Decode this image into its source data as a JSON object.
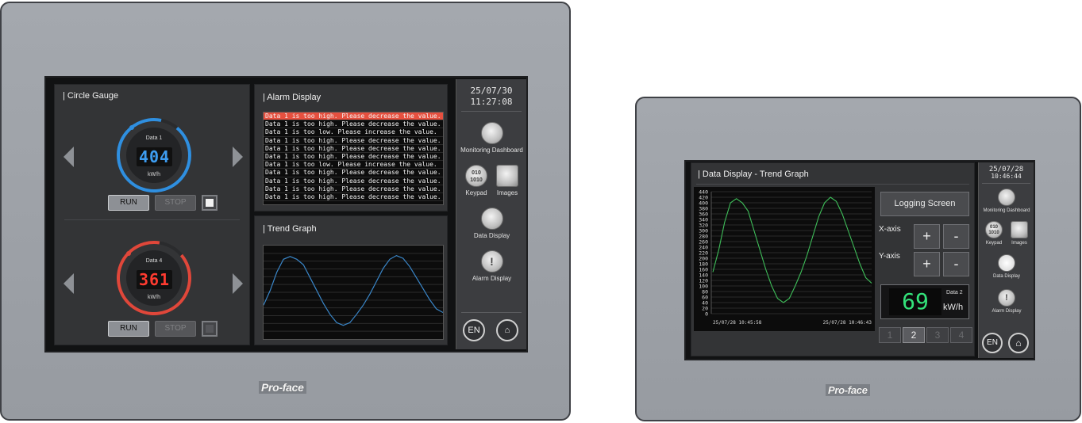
{
  "brand": "Pro-face",
  "colors": {
    "gauge_blue": "#2f8fe0",
    "gauge_red": "#e0473a",
    "alarm_highlight": "#e6503f",
    "trend_blue": "#3a86c8",
    "trend_green": "#3fbf5a",
    "value_green": "#33e27a"
  },
  "device1": {
    "circle_gauge": {
      "title": "| Circle Gauge",
      "gauges": [
        {
          "label": "Data 1",
          "value": "404",
          "unit": "kW/h",
          "color": "#2f8fe0",
          "digit_color": "#3d9cf0"
        },
        {
          "label": "Data 4",
          "value": "361",
          "unit": "kW/h",
          "color": "#e0473a",
          "digit_color": "#ff3b30"
        }
      ],
      "run_label": "RUN",
      "stop_label": "STOP"
    },
    "alarm_display": {
      "title": "| Alarm Display",
      "rows": [
        "Data 1 is too high. Please decrease the value.",
        "Data 1 is too high. Please decrease the value.",
        "Data 1 is too low. Please increase the value.",
        "Data 1 is too high. Please decrease the value.",
        "Data 1 is too high. Please decrease the value.",
        "Data 1 is too high. Please decrease the value.",
        "Data 1 is too low. Please increase the value.",
        "Data 1 is too high. Please decrease the value.",
        "Data 1 is too high. Please decrease the value.",
        "Data 1 is too high. Please decrease the value.",
        "Data 1 is too high. Please decrease the value."
      ]
    },
    "trend_graph": {
      "title": "| Trend Graph"
    },
    "sidebar": {
      "date": "25/07/30",
      "time": "11:27:08",
      "monitoring_label": "Monitoring Dashboard",
      "keypad_label": "Keypad",
      "images_label": "Images",
      "data_display_label": "Data Display",
      "alarm_display_label": "Alarm Display",
      "lang_label": "EN"
    }
  },
  "device2": {
    "title": "| Data Display - Trend Graph",
    "logging_label": "Logging Screen",
    "xaxis_label": "X-axis",
    "yaxis_label": "Y-axis",
    "plus": "+",
    "minus": "-",
    "value": "69",
    "value_label": "Data 2",
    "value_unit": "kW/h",
    "pages": [
      "1",
      "2",
      "3",
      "4"
    ],
    "active_page": "2",
    "x_start": "25/07/28 10:45:58",
    "x_end": "25/07/28 10:46:43",
    "sidebar": {
      "date": "25/07/28",
      "time": "10:46:44",
      "monitoring_label": "Monitoring Dashboard",
      "keypad_label": "Keypad",
      "images_label": "Images",
      "data_display_label": "Data Display",
      "alarm_display_label": "Alarm Display",
      "lang_label": "EN"
    }
  },
  "chart_data": {
    "type": "line",
    "ylim": [
      0,
      440
    ],
    "yticks": [
      "440",
      "420",
      "400",
      "380",
      "360",
      "340",
      "320",
      "300",
      "280",
      "260",
      "240",
      "220",
      "200",
      "180",
      "160",
      "140",
      "120",
      "100",
      "80",
      "60",
      "40",
      "20",
      "0"
    ],
    "xlabel": "",
    "ylabel": "",
    "series": [
      {
        "values": [
          150,
          230,
          330,
          400,
          415,
          400,
          370,
          300,
          230,
          160,
          100,
          55,
          40,
          55,
          100,
          150,
          210,
          280,
          350,
          400,
          420,
          405,
          360,
          300,
          240,
          180,
          130,
          110
        ]
      }
    ]
  }
}
